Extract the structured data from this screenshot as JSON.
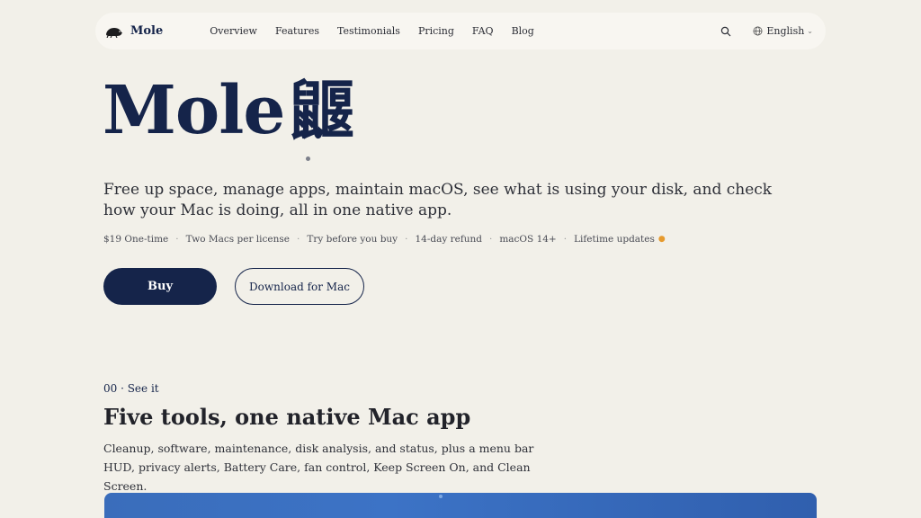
{
  "brand": {
    "name": "Mole"
  },
  "nav": {
    "links": [
      "Overview",
      "Features",
      "Testimonials",
      "Pricing",
      "FAQ",
      "Blog"
    ],
    "language": "English"
  },
  "hero": {
    "title": "Mole",
    "title_cjk": "鼴",
    "lead": "Free up space, manage apps, maintain macOS, see what is using your disk, and check how your Mac is doing, all in one native app.",
    "facts": [
      "$19 One-time",
      "Two Macs per license",
      "Try before you buy",
      "14-day refund",
      "macOS 14+",
      "Lifetime updates"
    ],
    "buy_label": "Buy",
    "download_label": "Download for Mac"
  },
  "section": {
    "eyebrow": "00 · See it",
    "title": "Five tools, one native Mac app",
    "description": "Cleanup, software, maintenance, disk analysis, and status, plus a menu bar HUD, privacy alerts, Battery Care, fan control, Keep Screen On, and Clean Screen."
  },
  "colors": {
    "accent": "#15244a",
    "background": "#f2f0e9",
    "star": "#e69a2e",
    "preview": "#3c73c6"
  },
  "icons": {
    "brand": "mole-icon",
    "search": "search-icon",
    "language": "globe-icon",
    "chevron": "chevron-down-icon"
  }
}
